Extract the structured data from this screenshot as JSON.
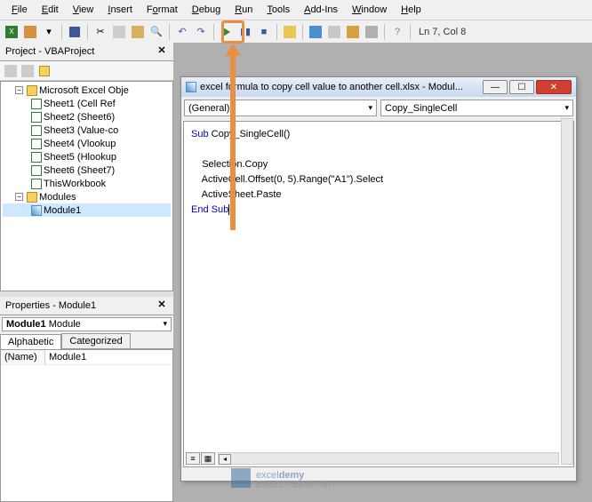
{
  "menu": {
    "items": [
      "File",
      "Edit",
      "View",
      "Insert",
      "Format",
      "Debug",
      "Run",
      "Tools",
      "Add-Ins",
      "Window",
      "Help"
    ]
  },
  "toolbar": {
    "position": "Ln 7, Col 8"
  },
  "project": {
    "pane_title": "Project - VBAProject",
    "root": "Microsoft Excel Obje",
    "sheets": [
      "Sheet1 (Cell Ref",
      "Sheet2 (Sheet6)",
      "Sheet3 (Value-co",
      "Sheet4 (Vlookup",
      "Sheet5 (Hlookup",
      "Sheet6 (Sheet7)",
      "ThisWorkbook"
    ],
    "modules_label": "Modules",
    "modules": [
      "Module1"
    ]
  },
  "properties": {
    "title": "Properties - Module1",
    "object": "Module1",
    "object_type": "Module",
    "tabs": [
      "Alphabetic",
      "Categorized"
    ],
    "rows": [
      {
        "name": "(Name)",
        "value": "Module1"
      }
    ]
  },
  "codewin": {
    "title": "excel formula to copy cell value to another cell.xlsx - Modul...",
    "left_combo": "(General)",
    "right_combo": "Copy_SingleCell",
    "code_lines": [
      {
        "pre": "Sub ",
        "plain": "Copy_SingleCell()"
      },
      {
        "plain": ""
      },
      {
        "plain": "    Selection.Copy"
      },
      {
        "plain": "    ActiveCell.Offset(0, 5).Range(\"A1\").Select"
      },
      {
        "plain": "    ActiveSheet.Paste"
      },
      {
        "pre": "End Sub",
        "plain": ""
      }
    ]
  },
  "watermark": {
    "brand_a": "excel",
    "brand_b": "demy",
    "sub": "EXCEL · DATA · BI"
  }
}
